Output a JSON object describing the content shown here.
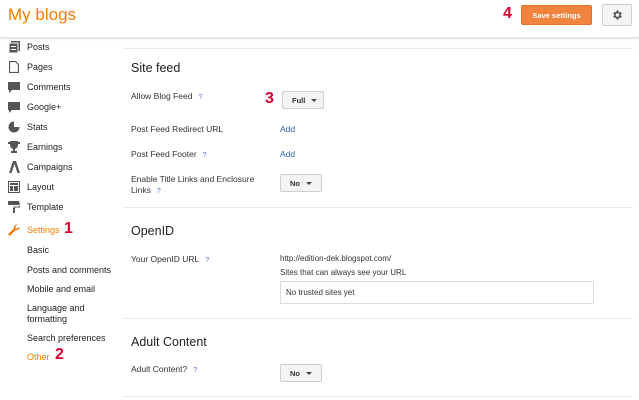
{
  "header": {
    "title": "My blogs",
    "save_label": "Save settings",
    "marker_save": "4"
  },
  "sidebar": {
    "items": [
      {
        "label": "Posts",
        "icon": "posts-icon"
      },
      {
        "label": "Pages",
        "icon": "pages-icon"
      },
      {
        "label": "Comments",
        "icon": "comments-icon"
      },
      {
        "label": "Google+",
        "icon": "google-plus-icon"
      },
      {
        "label": "Stats",
        "icon": "stats-icon"
      },
      {
        "label": "Earnings",
        "icon": "earnings-icon"
      },
      {
        "label": "Campaigns",
        "icon": "campaigns-icon"
      },
      {
        "label": "Layout",
        "icon": "layout-icon"
      },
      {
        "label": "Template",
        "icon": "template-icon"
      },
      {
        "label": "Settings",
        "icon": "wrench-icon",
        "active": true
      }
    ],
    "marker_settings": "1",
    "sub_items": [
      {
        "label": "Basic"
      },
      {
        "label": "Posts and comments"
      },
      {
        "label": "Mobile and email"
      },
      {
        "label": "Language and formatting"
      },
      {
        "label": "Search preferences"
      },
      {
        "label": "Other",
        "active": true
      }
    ],
    "marker_other": "2"
  },
  "main": {
    "site_feed": {
      "title": "Site feed",
      "allow_feed_label": "Allow Blog Feed",
      "allow_feed_value": "Full",
      "marker": "3",
      "redirect_label": "Post Feed Redirect URL",
      "redirect_link": "Add",
      "footer_label": "Post Feed Footer",
      "footer_link": "Add",
      "enclosure_label_1": "Enable Title Links and Enclosure",
      "enclosure_label_2": "Links",
      "enclosure_value": "No"
    },
    "openid": {
      "title": "OpenID",
      "url_label": "Your OpenID URL",
      "url_value": "http://edition-dek.blogspot.com/",
      "trusted_caption": "Sites that can always see your URL",
      "trusted_empty": "No trusted sites yet"
    },
    "adult": {
      "title": "Adult Content",
      "label": "Adult Content?",
      "value": "No"
    },
    "help_glyph": "?"
  },
  "colors": {
    "brand": "#f57d00",
    "save_button": "#f0843f",
    "link": "#2a5db0",
    "marker": "#d9002e"
  }
}
